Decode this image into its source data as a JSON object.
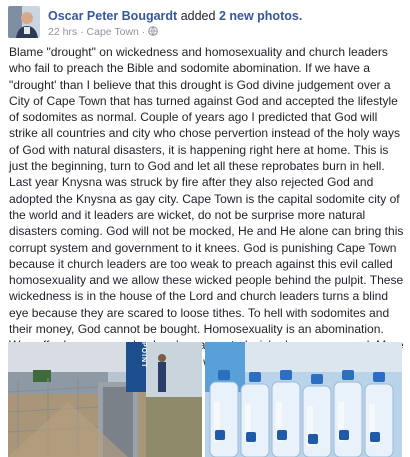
{
  "post": {
    "author": "Oscar Peter Bougardt",
    "action": "added",
    "photo_count": "2 new photos.",
    "time": "22 hrs",
    "separator": "·",
    "location": "Cape Town",
    "separator2": "·",
    "privacy_icon": "globe-icon",
    "text": "Blame \"drought\" on wickedness and homosexuality and church leaders who fail to preach the Bible and sodomite abomination. If we have a \"drought' than I believe that this drought is God divine judgement over a City of Cape Town that has turned against God and accepted the lifestyle of sodomites as normal. Couple of years ago I predicted that God will strike all countries and city who chose pervertion instead of the holy ways of God with natural disasters, it is happening right here at home. This is just the beginning, turn to God and let all these reprobates burn in hell. Last year Knysna was struck by fire after they also rejected God and adopted the Knysna as gay city. Cape Town is the capital sodomite city of the world and it leaders are wicket, do not be surprise more natural disasters coming. God will not be mocked, He and He alone can bring this corrupt system and government to it knees. God is punishing Cape Town because it church leaders are too weak to preach against this evil called homosexuality and we allow these wicked people behind the pulpit. These wickedness is in the house of the Lord and church leaders turns a blind eye because they are scared to loose tithes. To hell with sodomites and their money, God cannot be bought. Homosexuality is an abomination. We suffer because our leaders has accepted wickedness as normal. More disasters to follow, turn back to God wicked people.."
  },
  "photos": {
    "left_sign_text": "POINT"
  },
  "colors": {
    "link": "#365899",
    "meta": "#90949c",
    "text": "#1d2129"
  }
}
